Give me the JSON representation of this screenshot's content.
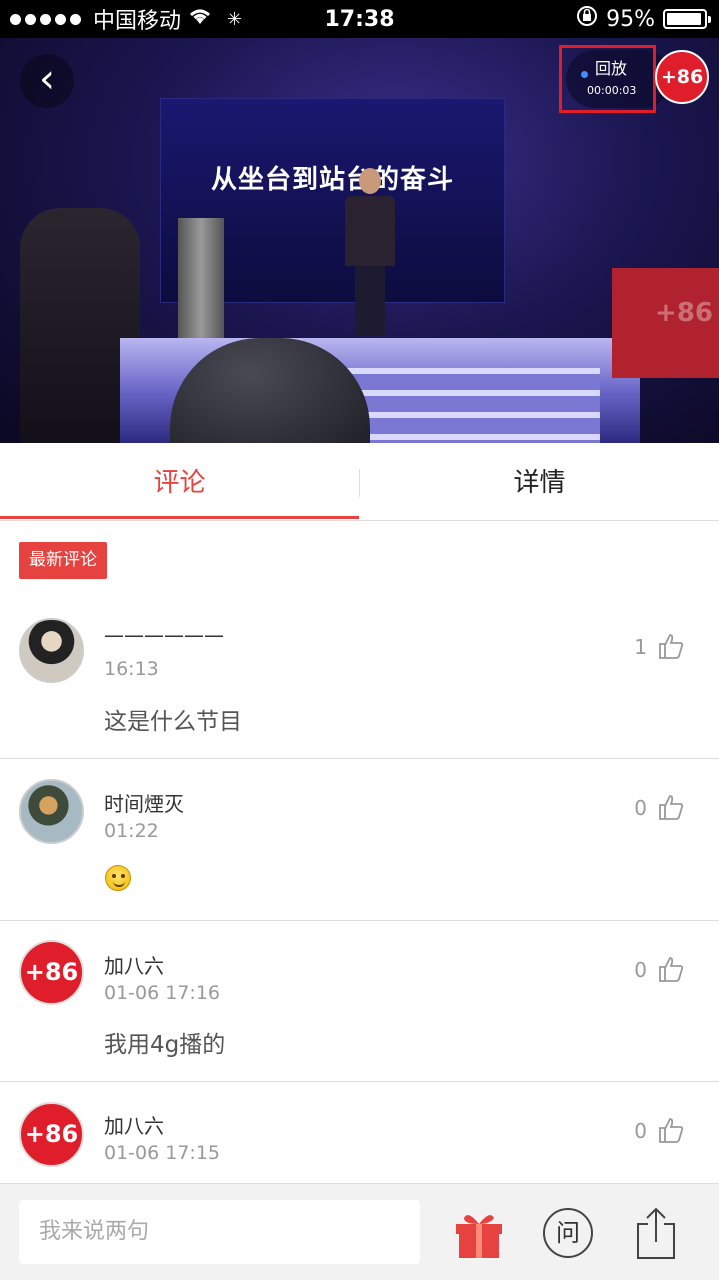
{
  "status_bar": {
    "carrier": "中国移动",
    "time": "17:38",
    "battery": "95%",
    "battery_level": 0.95
  },
  "video": {
    "screen_title": "从坐台到站台的奋斗",
    "replay_label": "回放",
    "replay_time": "00:00:03",
    "channel_badge": "+86",
    "stage_logo": "+86"
  },
  "tabs": [
    {
      "label": "评论",
      "active": true
    },
    {
      "label": "详情",
      "active": false
    }
  ],
  "section_badge": "最新评论",
  "comments": [
    {
      "name": "——————",
      "time": "16:13",
      "text": "这是什么节目",
      "likes": "1",
      "avatar": "photo-avatar"
    },
    {
      "name": "时间煙灭",
      "time": "01:22",
      "text": "",
      "emoji": "smile-emoji",
      "likes": "0",
      "avatar": "photo-avatar"
    },
    {
      "name": "加八六",
      "time": "01-06 17:16",
      "text": "我用4g播的",
      "likes": "0",
      "avatar": "+86"
    },
    {
      "name": "加八六",
      "time": "01-06 17:15",
      "text": "",
      "likes": "0",
      "avatar": "+86"
    }
  ],
  "bottom_bar": {
    "input_placeholder": "我来说两句",
    "ask_label": "问"
  },
  "colors": {
    "accent": "#e64340",
    "brand_red": "#e01e2b"
  }
}
